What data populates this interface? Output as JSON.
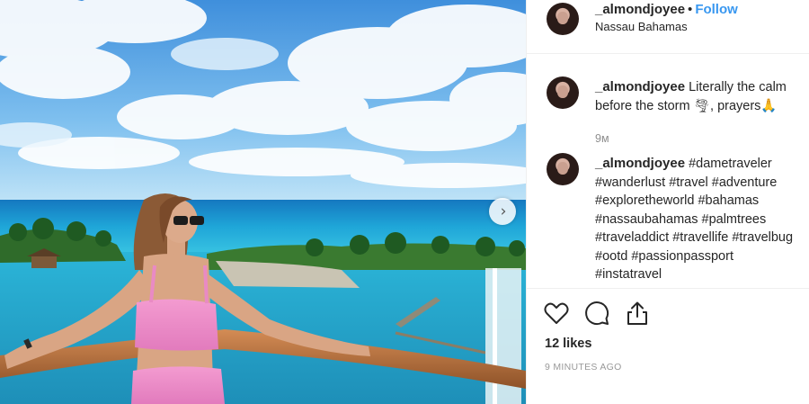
{
  "post": {
    "username": "_almondjoyee",
    "separator": "•",
    "follow_label": "Follow",
    "location": "Nassau Bahamas",
    "caption": {
      "username": "_almondjoyee",
      "text": "Literally the calm before the storm 🌪, prayers🙏"
    },
    "caption_time": "9м",
    "hashtag_comment": {
      "username": "_almondjoyee",
      "hashtags": "#dametraveler #wanderlust #travel #adventure #exploretheworld #bahamas #nassaubahamas #palmtrees #traveladdict #travellife #travelbug #ootd #passionpassport #instatravel"
    },
    "likes": "12 likes",
    "posted_ago": "9 MINUTES AGO"
  },
  "icons": {
    "next": "chevron-right-icon",
    "like": "heart-icon",
    "comment": "comment-icon",
    "share": "share-icon"
  },
  "colors": {
    "follow": "#3897f0",
    "sea": "#1aa6d6",
    "swimsuit": "#ee86c4"
  }
}
